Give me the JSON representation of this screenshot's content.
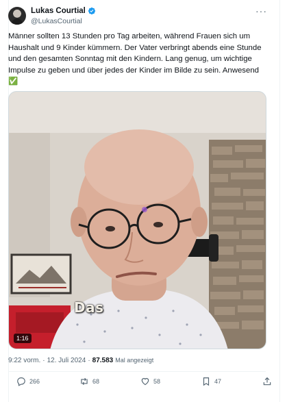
{
  "author": {
    "name": "Lukas Courtial",
    "handle": "@LukasCourtial",
    "verified": true
  },
  "tweet": {
    "text": "Männer sollten 13 Stunden pro Tag arbeiten, während Frauen sich um Haushalt und 9 Kinder kümmern. Der Vater verbringt abends eine Stunde und den gesamten Sonntag mit den Kindern. Lang genug, um wichtige Impulse zu geben und über jedes der Kinder im Bilde zu sein. Anwesend ✅"
  },
  "video": {
    "duration": "1:16",
    "caption": "Das"
  },
  "meta": {
    "time": "9:22 vorm.",
    "separator": "·",
    "date": "12. Juli 2024",
    "separator2": "·",
    "views": "87.583",
    "views_label": "Mal angezeigt"
  },
  "actions": {
    "replies": "266",
    "reposts": "68",
    "likes": "58",
    "bookmarks": "47"
  },
  "colors": {
    "verified": "#1d9bf0",
    "secondary_text": "#536471",
    "primary_text": "#0f1419"
  },
  "icons": [
    "more-icon",
    "verified-icon",
    "reply-icon",
    "repost-icon",
    "like-icon",
    "bookmark-icon",
    "share-icon"
  ]
}
